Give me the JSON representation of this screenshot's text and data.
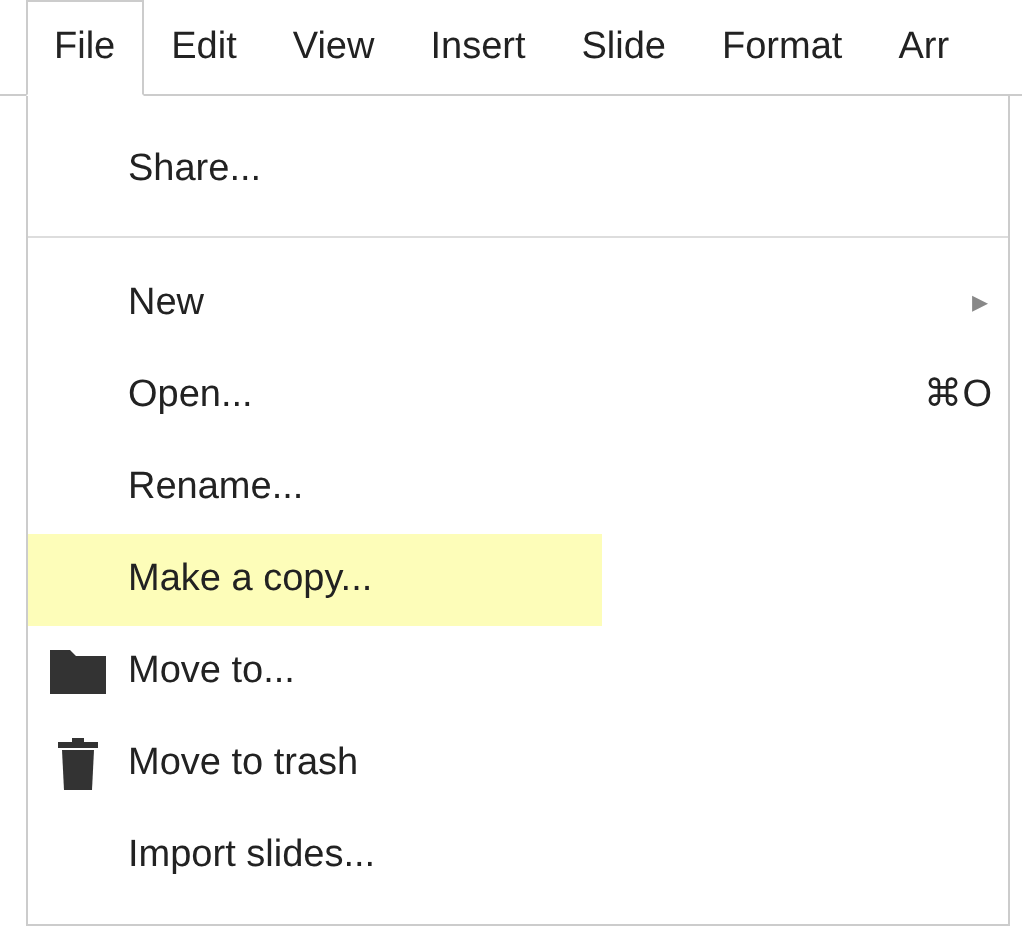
{
  "menubar": [
    {
      "label": "File",
      "selected": true
    },
    {
      "label": "Edit",
      "selected": false
    },
    {
      "label": "View",
      "selected": false
    },
    {
      "label": "Insert",
      "selected": false
    },
    {
      "label": "Slide",
      "selected": false
    },
    {
      "label": "Format",
      "selected": false
    },
    {
      "label": "Arr",
      "selected": false
    }
  ],
  "menu": [
    {
      "kind": "plain",
      "label": "Share...",
      "highlighted": false
    },
    {
      "kind": "separator"
    },
    {
      "kind": "plain",
      "label": "New",
      "submenu": "▸",
      "highlighted": false
    },
    {
      "kind": "plain",
      "label": "Open...",
      "shortcut": "⌘O",
      "highlighted": false
    },
    {
      "kind": "plain",
      "label": "Rename...",
      "highlighted": false
    },
    {
      "kind": "plain",
      "label": "Make a copy...",
      "highlighted": true
    },
    {
      "kind": "folder",
      "label": "Move to...",
      "highlighted": false
    },
    {
      "kind": "trash",
      "label": "Move to trash",
      "highlighted": false
    },
    {
      "kind": "plain",
      "label": "Import slides...",
      "highlighted": false
    }
  ]
}
